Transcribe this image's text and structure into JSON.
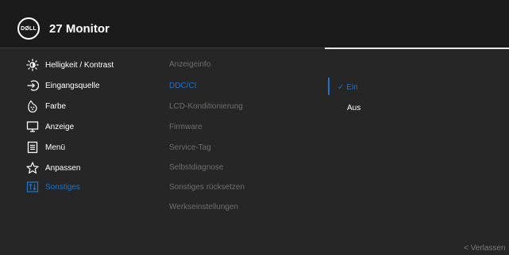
{
  "header": {
    "logo_text": "DØLL",
    "title": "27 Monitor"
  },
  "menu": [
    {
      "label": "Helligkeit / Kontrast",
      "icon": "brightness-icon"
    },
    {
      "label": "Eingangsquelle",
      "icon": "input-source-icon"
    },
    {
      "label": "Farbe",
      "icon": "color-icon"
    },
    {
      "label": "Anzeige",
      "icon": "display-icon"
    },
    {
      "label": "Menü",
      "icon": "menu-icon"
    },
    {
      "label": "Anpassen",
      "icon": "star-icon"
    },
    {
      "label": "Sonstiges",
      "icon": "others-icon"
    }
  ],
  "submenu": [
    "Anzeigeinfo",
    "DDC/CI",
    "LCD-Konditionierung",
    "Firmware",
    "Service-Tag",
    "Selbstdiagnose",
    "Sonstiges rücksetzen",
    "Werkseinstellungen"
  ],
  "options": {
    "selected_mark": "✓",
    "selected": "Ein",
    "other": "Aus"
  },
  "footer": {
    "exit_label": "Verlassen",
    "exit_icon": "chevron-left-icon"
  },
  "colors": {
    "accent": "#1d73c9",
    "background": "#262626",
    "header": "#1b1b1b",
    "inactive_text": "#6e6e6e"
  }
}
